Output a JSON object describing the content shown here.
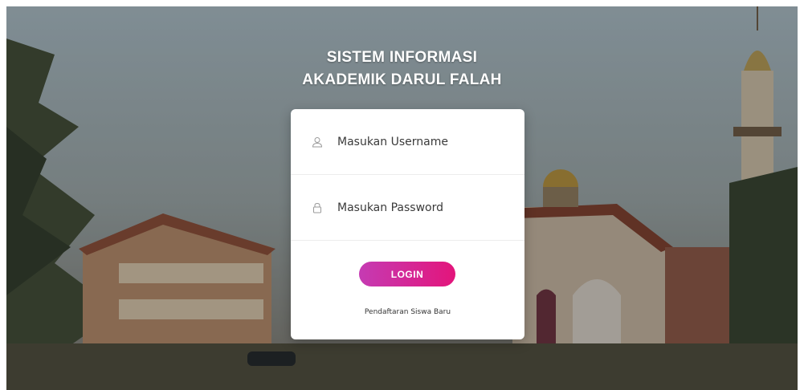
{
  "header": {
    "title_line1": "SISTEM INFORMASI",
    "title_line2": "AKADEMIK DARUL FALAH"
  },
  "login_form": {
    "username_placeholder": "Masukan Username",
    "password_placeholder": "Masukan Password",
    "login_label": "LOGIN",
    "register_link": "Pendaftaran Siswa Baru"
  },
  "icons": {
    "username": "user-icon",
    "password": "lock-icon"
  },
  "colors": {
    "button_start": "#c53bb3",
    "button_end": "#e3157b",
    "card_background": "#ffffff",
    "title_text": "#ffffff"
  }
}
